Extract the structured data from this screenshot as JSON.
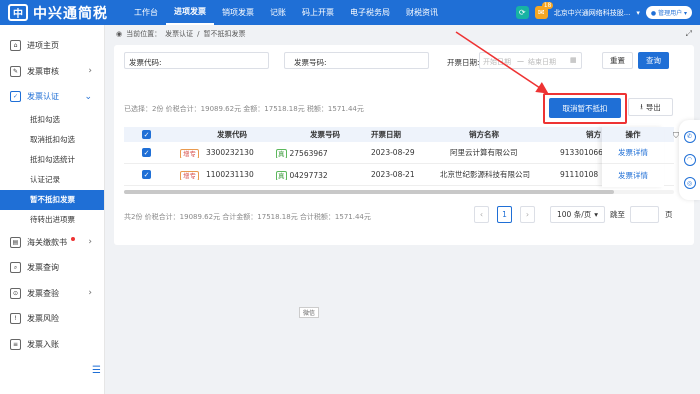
{
  "app": {
    "logo_mark": "中",
    "name": "中兴通简税"
  },
  "nav": [
    "工作台",
    "进项发票",
    "销项发票",
    "记账",
    "码上开票",
    "电子税务局",
    "财税资讯"
  ],
  "topbar": {
    "badge": "18",
    "company": "北京中兴通网络科技股...",
    "user": "管理用户"
  },
  "sidebar": {
    "items": [
      {
        "label": "进项主页",
        "icon": "home-icon"
      },
      {
        "label": "发票审核",
        "icon": "audit-icon",
        "chevron": "›"
      },
      {
        "label": "发票认证",
        "icon": "certify-icon",
        "chevron": "⌄"
      },
      {
        "label": "海关缴款书",
        "icon": "customs-icon",
        "chevron": "›"
      },
      {
        "label": "发票查询",
        "icon": "query-icon"
      },
      {
        "label": "发票查验",
        "icon": "verify-icon",
        "chevron": "›"
      },
      {
        "label": "发票风险",
        "icon": "risk-icon"
      },
      {
        "label": "发票入账",
        "icon": "ledger-icon"
      }
    ],
    "sub_items": [
      "抵扣勾选",
      "取消抵扣勾选",
      "抵扣勾选统计",
      "认证记录",
      "暂不抵扣发票",
      "待转出进项票"
    ]
  },
  "breadcrumb": {
    "prefix": "当前位置：",
    "level1": "发票认证",
    "sep": "/",
    "level2": "暂不抵扣发票"
  },
  "filters": {
    "code_label": "发票代码:",
    "number_label": "发票号码:",
    "date_label": "开票日期:",
    "date_start_ph": "开始日期",
    "date_sep": "—",
    "date_end_ph": "结束日期",
    "reset": "重置",
    "query": "查询"
  },
  "summary": "已选择：2份 价税合计：19089.62元 金额：17518.18元 税额：1571.44元",
  "actions": {
    "cancel": "取消暂不抵扣",
    "export": "导出"
  },
  "table": {
    "headers": [
      "发票代码",
      "发票号码",
      "开票日期",
      "销方名称",
      "销方",
      "操作"
    ],
    "rows": [
      {
        "type": "增专",
        "code": "3300232130",
        "zhen": "真",
        "number": "27563967",
        "date": "2023-08-29",
        "seller": "阿里云计算有限公司",
        "tax_id": "913301066",
        "action": "发票详情"
      },
      {
        "type": "增专",
        "code": "1100231130",
        "zhen": "真",
        "number": "04297732",
        "date": "2023-08-21",
        "seller": "北京世纪影源科技有限公司",
        "tax_id": "91110108",
        "action": "发票详情"
      }
    ]
  },
  "footer": {
    "summary": "共2份 价税合计：19089.62元 合计金额：17518.18元 合计税额：1571.44元",
    "page": "1",
    "page_size": "100 条/页",
    "goto": "跳至",
    "page_unit": "页"
  },
  "tooltip": "微信"
}
